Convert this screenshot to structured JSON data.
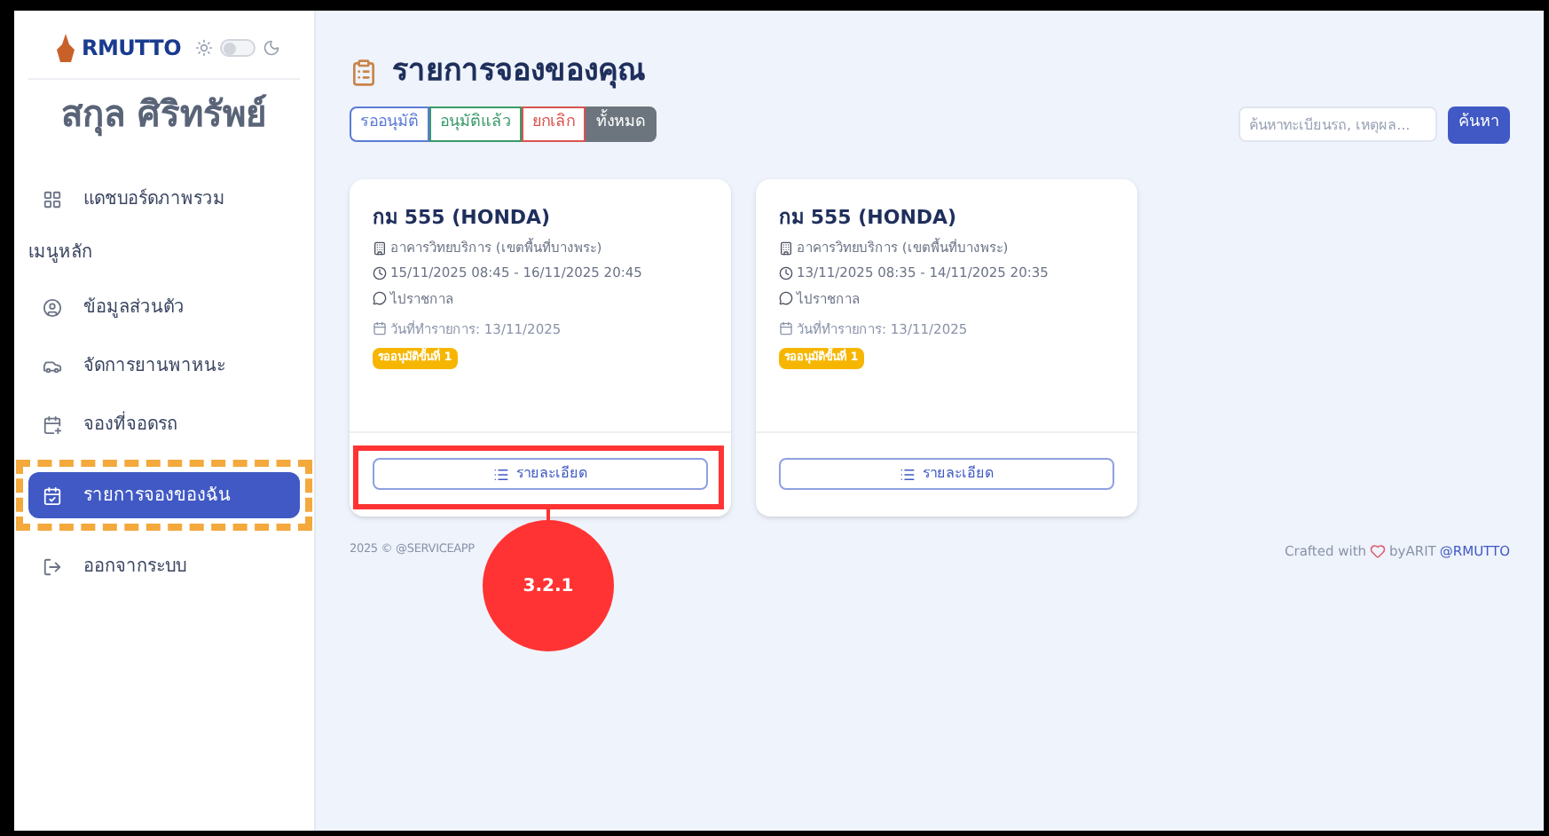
{
  "sidebar": {
    "logo_text": "RMUTTO",
    "theme_toggle": {
      "on": false
    },
    "user_name": "สกุล ศิริทรัพย์",
    "items": [
      {
        "kind": "link",
        "label": "แดชบอร์ดภาพรวม",
        "selected": false
      },
      {
        "kind": "section",
        "label": "เมนูหลัก"
      },
      {
        "kind": "link",
        "label": "ข้อมูลส่วนตัว",
        "selected": false
      },
      {
        "kind": "link",
        "label": "จัดการยานพาหนะ",
        "selected": false
      },
      {
        "kind": "link",
        "label": "จองที่จอดรถ",
        "selected": false
      },
      {
        "kind": "link",
        "label": "รายการจองของฉัน",
        "selected": true
      },
      {
        "kind": "link",
        "label": "ออกจากระบบ",
        "selected": false
      }
    ]
  },
  "page_title": "รายการจองของคุณ",
  "filters": [
    {
      "label": "รออนุมัติ",
      "color": "#5b7bd5",
      "selected": false
    },
    {
      "label": "อนุมัติแล้ว",
      "color": "#3a9a6a",
      "selected": false
    },
    {
      "label": "ยกเลิก",
      "color": "#d9534f",
      "selected": false
    },
    {
      "label": "ทั้งหมด",
      "color": "#6c757d",
      "selected": true
    }
  ],
  "search": {
    "placeholder": "ค้นหาทะเบียนรถ, เหตุผล...",
    "button": "ค้นหา"
  },
  "bookings": [
    {
      "plate": "กม 555 (HONDA)",
      "location": "อาคารวิทยบริการ (เขตพื้นที่บางพระ)",
      "time": "15/11/2025 08:45 - 16/11/2025 20:45",
      "note": "ไปราชกาล",
      "created": "วันที่ทำรายการ: 13/11/2025",
      "status": "รออนุมัติขั้นที่ 1",
      "button": "รายละเอียด"
    },
    {
      "plate": "กม 555 (HONDA)",
      "location": "อาคารวิทยบริการ (เขตพื้นที่บางพระ)",
      "time": "13/11/2025 08:35 - 14/11/2025 20:35",
      "note": "ไปราชกาล",
      "created": "วันที่ทำรายการ: 13/11/2025",
      "status": "รออนุมัติขั้นที่ 1",
      "button": "รายละเอียด"
    }
  ],
  "footer": {
    "copyright": "2025 © @SERVICEAPP",
    "crafted": "Crafted with",
    "by": "byARIT",
    "link": "@RMUTTO"
  },
  "callout": {
    "label": "3.2.1"
  }
}
